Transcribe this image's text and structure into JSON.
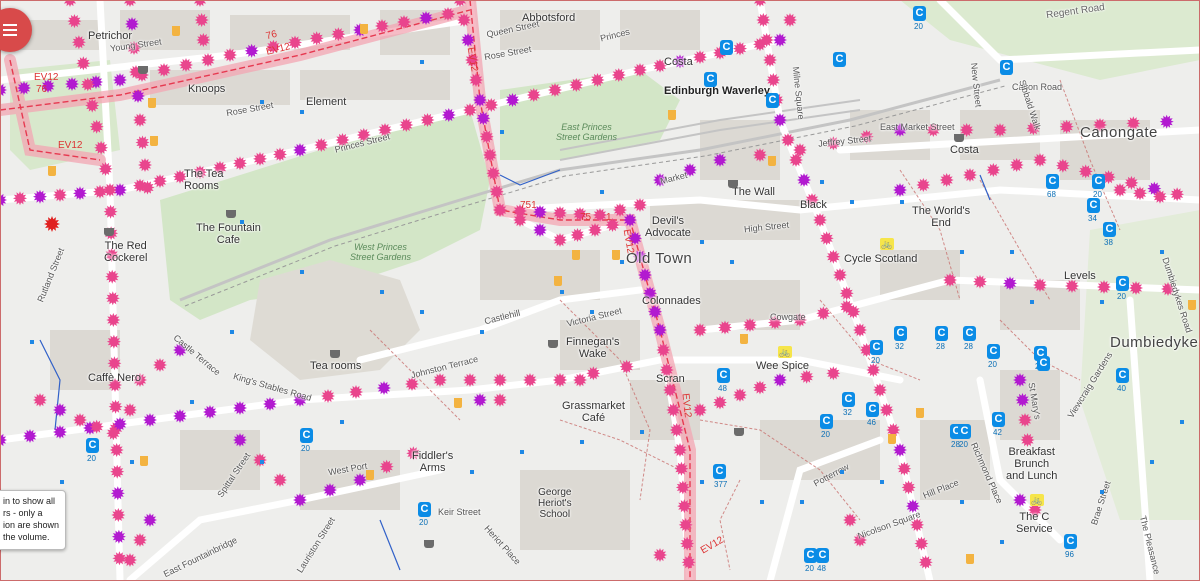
{
  "map": {
    "labels": {
      "districts": {
        "old_town": "Old Town",
        "canongate": "Canongate",
        "dumbiedykes": "Dumbiedykes"
      },
      "places": {
        "abbotsford": "Abbotsford",
        "petrichor": "Petrichor",
        "knoops": "Knoops",
        "element": "Element",
        "costa_north": "Costa",
        "edinburgh_waverley": "Edinburgh Waverley",
        "costa_east": "Costa",
        "the_wall": "The Wall",
        "the_tea_rooms": "The Tea Rooms",
        "the_fountain_cafe": "The Fountain\nCafe",
        "the_red_cockerel": "The Red\nCockerel",
        "devils_advocate": "Devil's\nAdvocate",
        "blackfriars": "Black",
        "the_worlds_end": "The World's\nEnd",
        "cycle_scotland": "Cycle Scotland",
        "levels": "Levels",
        "colonnades": "Colonnades",
        "finnegans_wake": "Finnegan's\nWake",
        "tea_rooms": "Tea rooms",
        "caffe_nero": "Caffè Nero",
        "grassmarket_cafe": "Grassmarket\nCafé",
        "wee_spice": "Wee Spice",
        "scran": "Scran",
        "fiddlers_arms": "Fiddler's\nArms",
        "george_heriots_school": "George\nHeriot's\nSchool",
        "breakfast_brunch_lunch": "Breakfast\nBrunch\nand Lunch",
        "the_service": "The C\nService"
      },
      "streets": {
        "young_street": "Young Street",
        "rose_street_w": "Rose Street",
        "rose_street_e": "Rose Street",
        "princes_street": "Princes Street",
        "queen_street": "Queen Street",
        "princes_st_e": "Princes",
        "regent_road": "Regent Road",
        "calton_road": "Calton Road",
        "east_market_street": "East Market Street",
        "jeffrey_street": "Jeffrey Street",
        "high_street": "High Street",
        "market_street": "Market",
        "castlehill": "Castlehill",
        "victoria_street": "Victoria Street",
        "cowgate": "Cowgate",
        "johnston_terrace": "Johnston Terrace",
        "kings_stables_road": "King's Stables Road",
        "west_port": "West Port",
        "keir_street": "Keir Street",
        "heriot_place": "Heriot Place",
        "spittal_street": "Spittal Street",
        "lauriston_street": "Lauriston Street",
        "east_fountainbridge": "East Fountainbridge",
        "rutland_street": "Rutland Street",
        "castle_terrace": "Castle Terrace",
        "potterrow": "Potterrow",
        "nicolson_square": "Nicolson Square",
        "richmond_place": "Richmond Place",
        "hill_place": "Hill Place",
        "new_street": "New Street",
        "viewcraig_gardens": "Viewcraig Gardens",
        "dumbiedykes_road": "Dumbiedykes Road",
        "bowling_green": "Brae Street",
        "pleasance": "The Pleasance",
        "st_marys": "St Mary's",
        "sibbald_walk": "Sibbald Walk",
        "milne_square": "Milne Square"
      },
      "parks": {
        "east_princes_street_gardens": "East Princes\nStreet Gardens",
        "west_princes_street_gardens": "West Princes\nStreet Gardens"
      },
      "routes": {
        "ev12": "EV12",
        "r76": "76",
        "r751": "751",
        "r75": "75",
        "r1": "1"
      }
    },
    "cycle_parking_numbers": [
      "20",
      "68",
      "20",
      "34",
      "38",
      "20",
      "40",
      "32",
      "28",
      "28",
      "20",
      "24",
      "20",
      "48",
      "32",
      "20",
      "20",
      "46",
      "28",
      "20",
      "42",
      "377",
      "96",
      "20",
      "48",
      "20",
      "20"
    ],
    "colors": {
      "route_red": "#e63950",
      "marker_pink": "#e9458d",
      "marker_purple": "#b21ad0",
      "park_green": "#cfe3c1",
      "road_white": "#ffffff",
      "building": "#d9d6d0",
      "rail": "#bdbdbd",
      "bus_blue": "#1e88e5"
    }
  },
  "controls": {
    "menu_icon": "hamburger-icon"
  },
  "info_box": {
    "text": "in to show all\nrs - only a\nion are shown\nthe volume."
  }
}
